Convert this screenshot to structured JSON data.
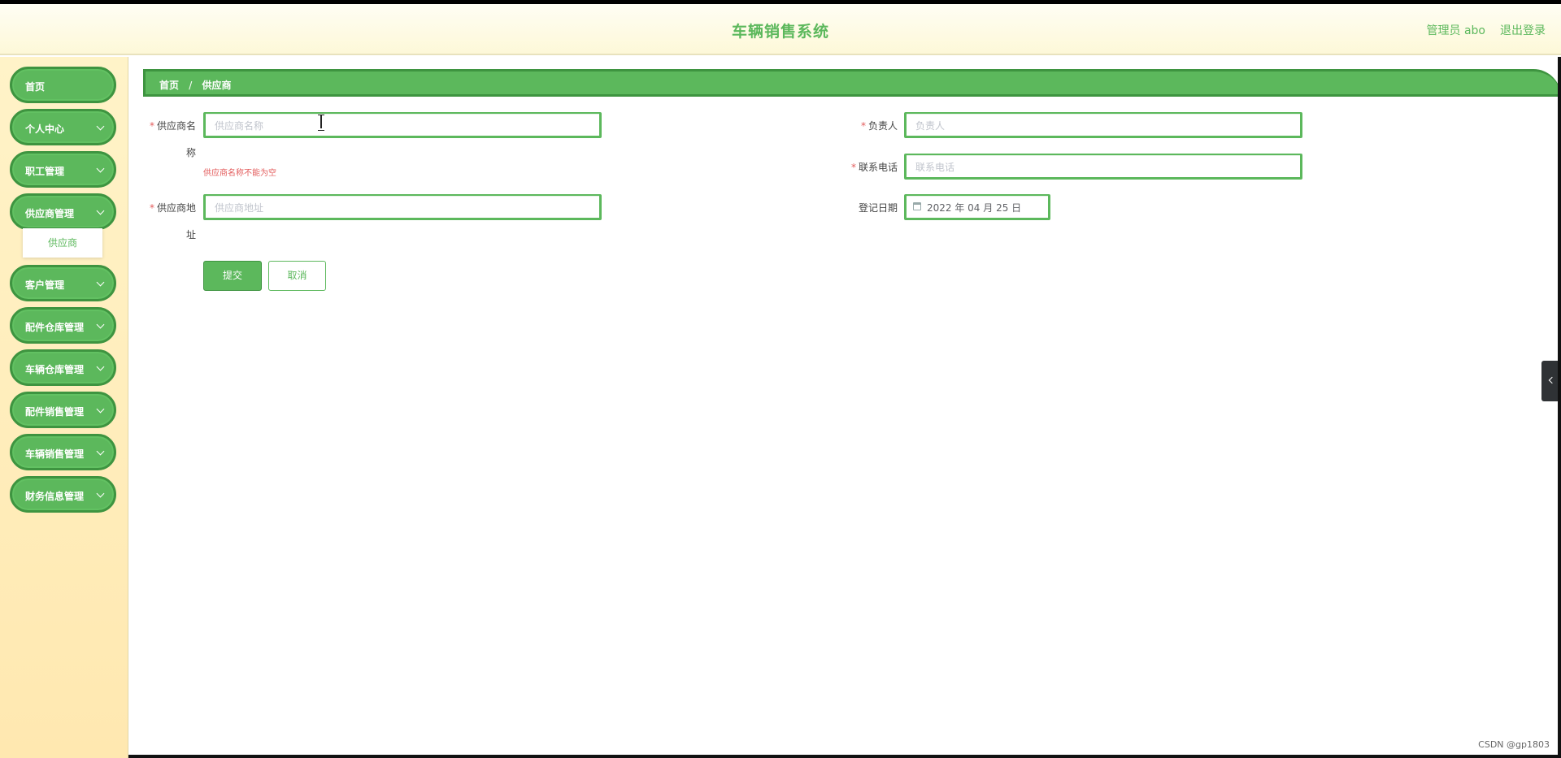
{
  "header": {
    "title": "车辆销售系统",
    "user_label": "管理员 abo",
    "logout_label": "退出登录"
  },
  "sidebar": {
    "items": [
      {
        "label": "首页",
        "has_children": false
      },
      {
        "label": "个人中心",
        "has_children": true
      },
      {
        "label": "职工管理",
        "has_children": true
      },
      {
        "label": "供应商管理",
        "has_children": true,
        "expanded": true
      },
      {
        "label": "客户管理",
        "has_children": true
      },
      {
        "label": "配件仓库管理",
        "has_children": true
      },
      {
        "label": "车辆仓库管理",
        "has_children": true
      },
      {
        "label": "配件销售管理",
        "has_children": true
      },
      {
        "label": "车辆销售管理",
        "has_children": true
      },
      {
        "label": "财务信息管理",
        "has_children": true
      }
    ],
    "submenu_active": "供应商"
  },
  "breadcrumb": {
    "home": "首页",
    "separator": "/",
    "current": "供应商"
  },
  "form": {
    "supplier_name": {
      "label_line1": "供应商名",
      "label_line2": "称",
      "placeholder": "供应商名称",
      "required": true,
      "error": "供应商名称不能为空"
    },
    "contact_person": {
      "label": "负责人",
      "placeholder": "负责人",
      "required": true
    },
    "phone": {
      "label": "联系电话",
      "placeholder": "联系电话",
      "required": true
    },
    "address": {
      "label_line1": "供应商地",
      "label_line2": "址",
      "placeholder": "供应商地址",
      "required": true
    },
    "register_date": {
      "label": "登记日期",
      "value": "2022 年 04 月 25 日",
      "required": false
    },
    "submit_label": "提交",
    "cancel_label": "取消"
  },
  "watermark": "CSDN @gp1803",
  "colors": {
    "accent": "#5cb85c",
    "accent_dark": "#3e9440",
    "error": "#e35d5d",
    "sidebar_bg": "#ffeeb8"
  }
}
